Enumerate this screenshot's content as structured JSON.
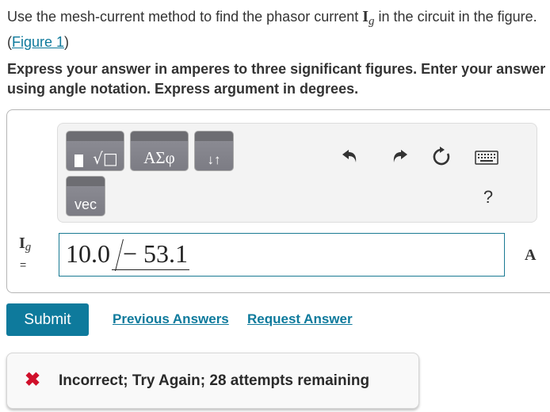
{
  "prompt": {
    "text_before": "Use the mesh-current method to find the phasor current ",
    "var_main": "I",
    "var_sub": "g",
    "text_after": " in the circuit in the figure.(",
    "figure_link": "Figure 1",
    "text_end": ")"
  },
  "instructions": "Express your answer in amperes to three significant figures. Enter your answer using angle notation. Express argument in degrees.",
  "toolbar": {
    "templates_label": "√□",
    "greek_label": "ΑΣφ",
    "arrows_label": "↓↑",
    "vec_label": "vec",
    "help_label": "?"
  },
  "answer": {
    "var_main": "I",
    "var_sub": "g",
    "equals": "=",
    "magnitude": "10.0",
    "angle": "− 53.1",
    "unit": "A"
  },
  "actions": {
    "submit_label": "Submit",
    "previous_answers_label": "Previous Answers",
    "request_answer_label": "Request Answer"
  },
  "feedback": {
    "icon": "✖",
    "text": "Incorrect; Try Again; 28 attempts remaining"
  },
  "colors": {
    "accent": "#0e7a9c",
    "error": "#d0102b"
  }
}
